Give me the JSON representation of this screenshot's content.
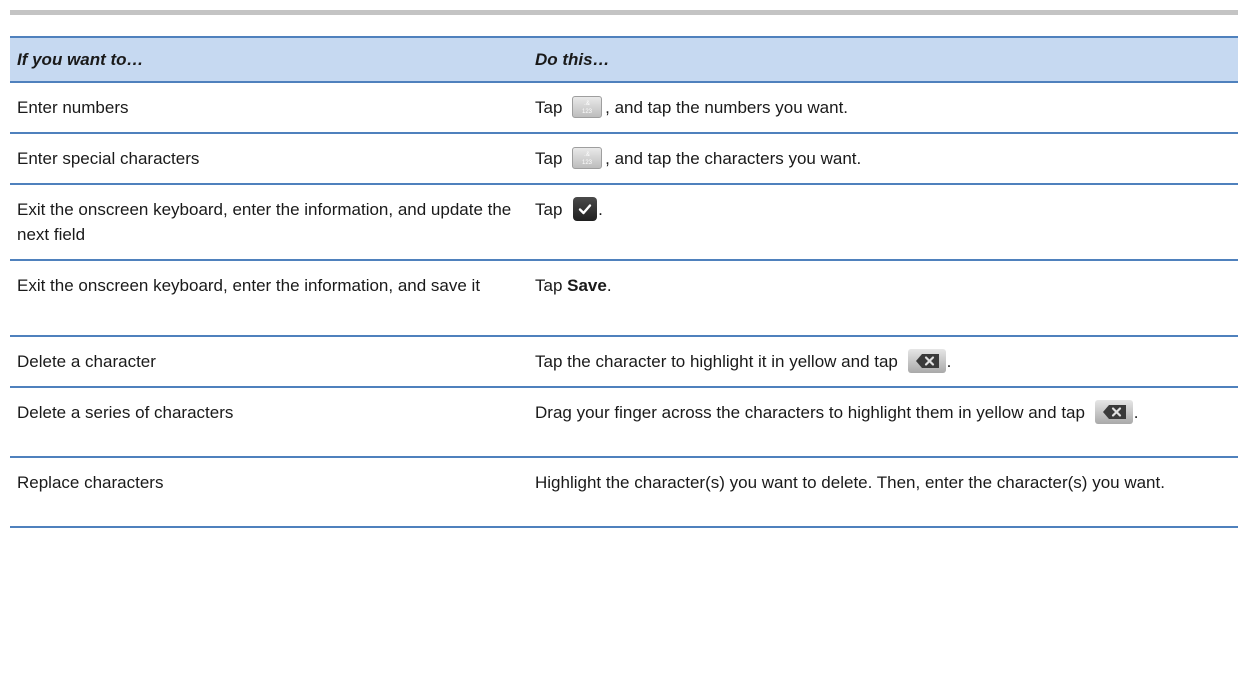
{
  "table": {
    "headers": [
      "If you want to…",
      "Do this…"
    ],
    "rows": [
      {
        "action": "Enter numbers",
        "instruction": {
          "before": "Tap ",
          "icon": "numbers-key-icon",
          "after": ", and tap the numbers you want."
        }
      },
      {
        "action": "Enter special characters",
        "instruction": {
          "before": "Tap ",
          "icon": "numbers-key-icon",
          "after": ", and tap the characters you want."
        }
      },
      {
        "action": "Exit the onscreen keyboard, enter the information, and update the next field",
        "instruction": {
          "before": "Tap ",
          "icon": "checkmark-key-icon",
          "after": "."
        }
      },
      {
        "action": "Exit the onscreen keyboard, enter the information, and save it",
        "instruction": {
          "before": "Tap ",
          "bold": "Save",
          "after": "."
        }
      },
      {
        "action": "Delete a character",
        "instruction": {
          "before": "Tap the character to highlight it in yellow and tap ",
          "icon": "backspace-key-icon",
          "after": "."
        }
      },
      {
        "action": "Delete a series of characters",
        "instruction": {
          "before": "Drag your finger across the characters to highlight them in yellow and tap ",
          "icon": "backspace-key-icon",
          "after": "."
        }
      },
      {
        "action": "Replace characters",
        "instruction": {
          "text": "Highlight the character(s) you want to delete. Then, enter the character(s) you want."
        }
      }
    ]
  },
  "key_labels": {
    "numbers_key_top": ".&",
    "numbers_key_bottom": "123"
  },
  "colors": {
    "header_background": "#c6d9f1",
    "rule": "#4f81bd",
    "top_bar": "#c4c4c4"
  }
}
